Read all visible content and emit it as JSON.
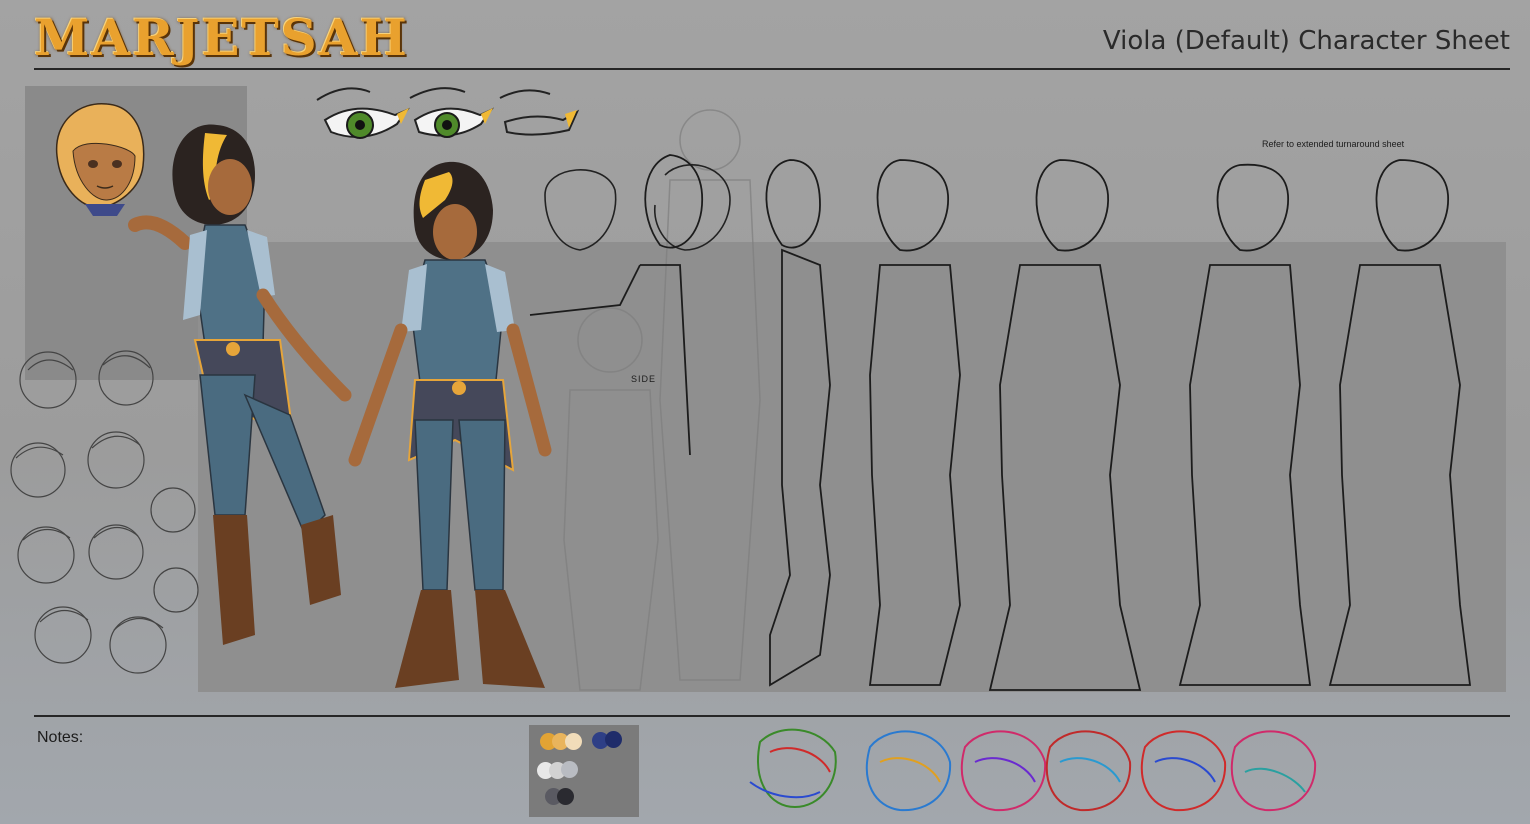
{
  "header": {
    "logo_text": "MARJETSAH",
    "sheet_title": "Viola (Default) Character Sheet"
  },
  "turnaround": {
    "note": "Refer to extended turnaround sheet",
    "side_label": "SIDE"
  },
  "footer": {
    "notes_label": "Notes:"
  },
  "palette": {
    "swatches": [
      "#e2a334",
      "#e9b45c",
      "#f1dcb9",
      "#2e3f86",
      "#1f2c6a",
      "#e8e8e8",
      "#d2d2d2",
      "#b9bcc2",
      "#5a5a62",
      "#2a2a30"
    ]
  },
  "colors": {
    "skin": "#a66a3c",
    "hair": "#2b2320",
    "hair_streak": "#f0b935",
    "top": "#4f7186",
    "sleeve": "#a9bfd0",
    "vest": "#45485a",
    "pants": "#4a6b80",
    "boots": "#6a3f22",
    "trim": "#e6a53a"
  },
  "icons": {
    "logo": "marjetsah-logo",
    "eye": "eye-study-icon"
  }
}
